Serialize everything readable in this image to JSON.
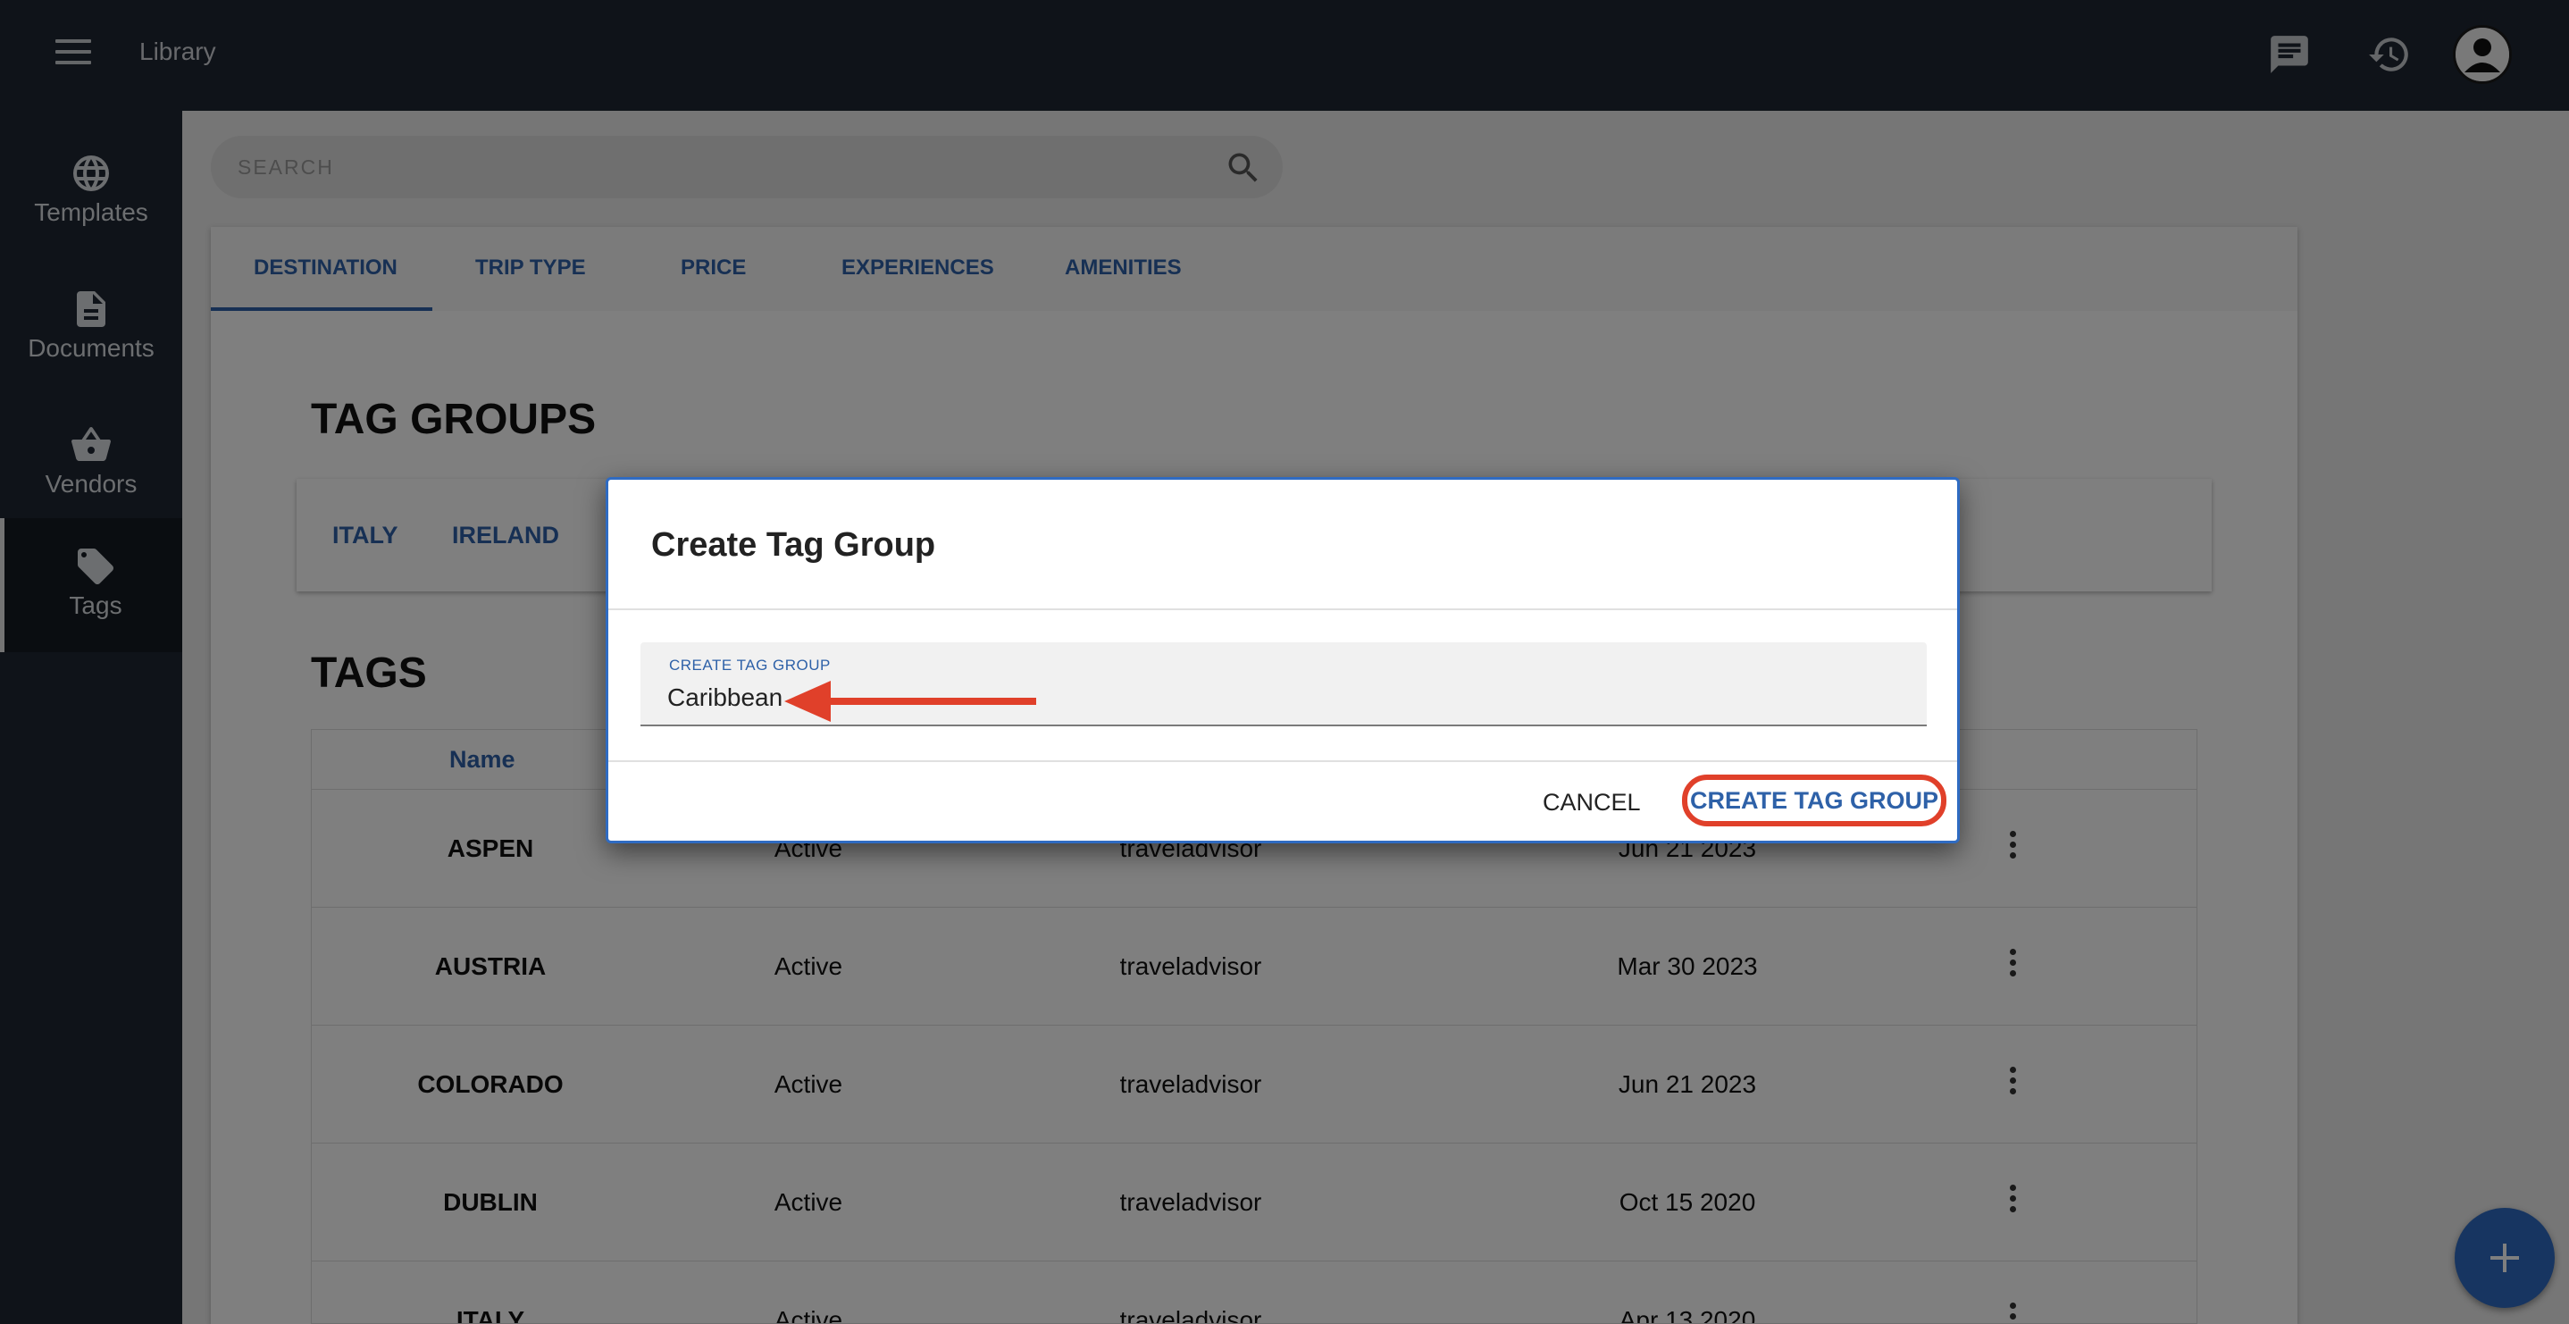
{
  "header": {
    "title": "Library",
    "icons": [
      "menu-icon",
      "chat-icon",
      "history-icon",
      "user-avatar"
    ]
  },
  "sidebar": {
    "items": [
      {
        "label": "Templates",
        "icon": "globe-icon"
      },
      {
        "label": "Documents",
        "icon": "document-icon"
      },
      {
        "label": "Vendors",
        "icon": "basket-icon"
      },
      {
        "label": "Tags",
        "icon": "tag-icon",
        "active": true
      }
    ]
  },
  "search": {
    "placeholder": "SEARCH"
  },
  "tabs": [
    "DESTINATION",
    "TRIP TYPE",
    "PRICE",
    "EXPERIENCES",
    "AMENITIES"
  ],
  "tag_groups": {
    "heading": "TAG GROUPS",
    "items": [
      "ITALY",
      "IRELAND"
    ]
  },
  "tags": {
    "heading": "TAGS",
    "columns": [
      "Name"
    ],
    "rows": [
      {
        "name": "ASPEN",
        "status": "Active",
        "owner": "traveladvisor",
        "date": "Jun 21 2023"
      },
      {
        "name": "AUSTRIA",
        "status": "Active",
        "owner": "traveladvisor",
        "date": "Mar 30 2023"
      },
      {
        "name": "COLORADO",
        "status": "Active",
        "owner": "traveladvisor",
        "date": "Jun 21 2023"
      },
      {
        "name": "DUBLIN",
        "status": "Active",
        "owner": "traveladvisor",
        "date": "Oct 15 2020"
      },
      {
        "name": "ITALY",
        "status": "Active",
        "owner": "traveladvisor",
        "date": "Apr 13 2020"
      }
    ]
  },
  "dialog": {
    "title": "Create Tag Group",
    "field_label": "CREATE TAG GROUP",
    "field_value": "Caribbean",
    "cancel_label": "CANCEL",
    "create_label": "CREATE TAG GROUP"
  },
  "colors": {
    "accent": "#2e61a8",
    "nav_bg": "#1e2633",
    "annotation": "#e0402a"
  }
}
